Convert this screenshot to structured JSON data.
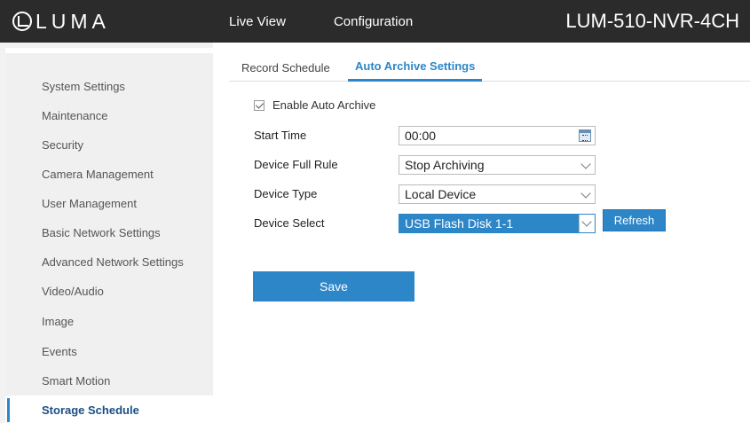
{
  "header": {
    "logo_text": "LUMA",
    "nav": [
      "Live View",
      "Configuration"
    ],
    "device_model": "LUM-510-NVR-4CH"
  },
  "sidebar": {
    "items": [
      {
        "label": "System Settings"
      },
      {
        "label": "Maintenance"
      },
      {
        "label": "Security"
      },
      {
        "label": "Camera Management"
      },
      {
        "label": "User Management"
      },
      {
        "label": "Basic Network Settings"
      },
      {
        "label": "Advanced Network Settings"
      },
      {
        "label": "Video/Audio"
      },
      {
        "label": "Image"
      },
      {
        "label": "Events"
      },
      {
        "label": "Smart Motion"
      },
      {
        "label": "Storage Schedule",
        "active": true
      }
    ]
  },
  "tabs": [
    {
      "label": "Record Schedule"
    },
    {
      "label": "Auto Archive Settings",
      "active": true
    }
  ],
  "form": {
    "enable_label": "Enable Auto Archive",
    "enable_checked": true,
    "start_time_label": "Start Time",
    "start_time_value": "00:00",
    "full_rule_label": "Device Full Rule",
    "full_rule_value": "Stop Archiving",
    "device_type_label": "Device Type",
    "device_type_value": "Local Device",
    "device_select_label": "Device Select",
    "device_select_value": "USB Flash Disk 1-1",
    "refresh_label": "Refresh",
    "save_label": "Save"
  },
  "colors": {
    "accent": "#2d86c8",
    "header_bg": "#2b2b2b",
    "sidebar_bg": "#f0f0f0"
  }
}
